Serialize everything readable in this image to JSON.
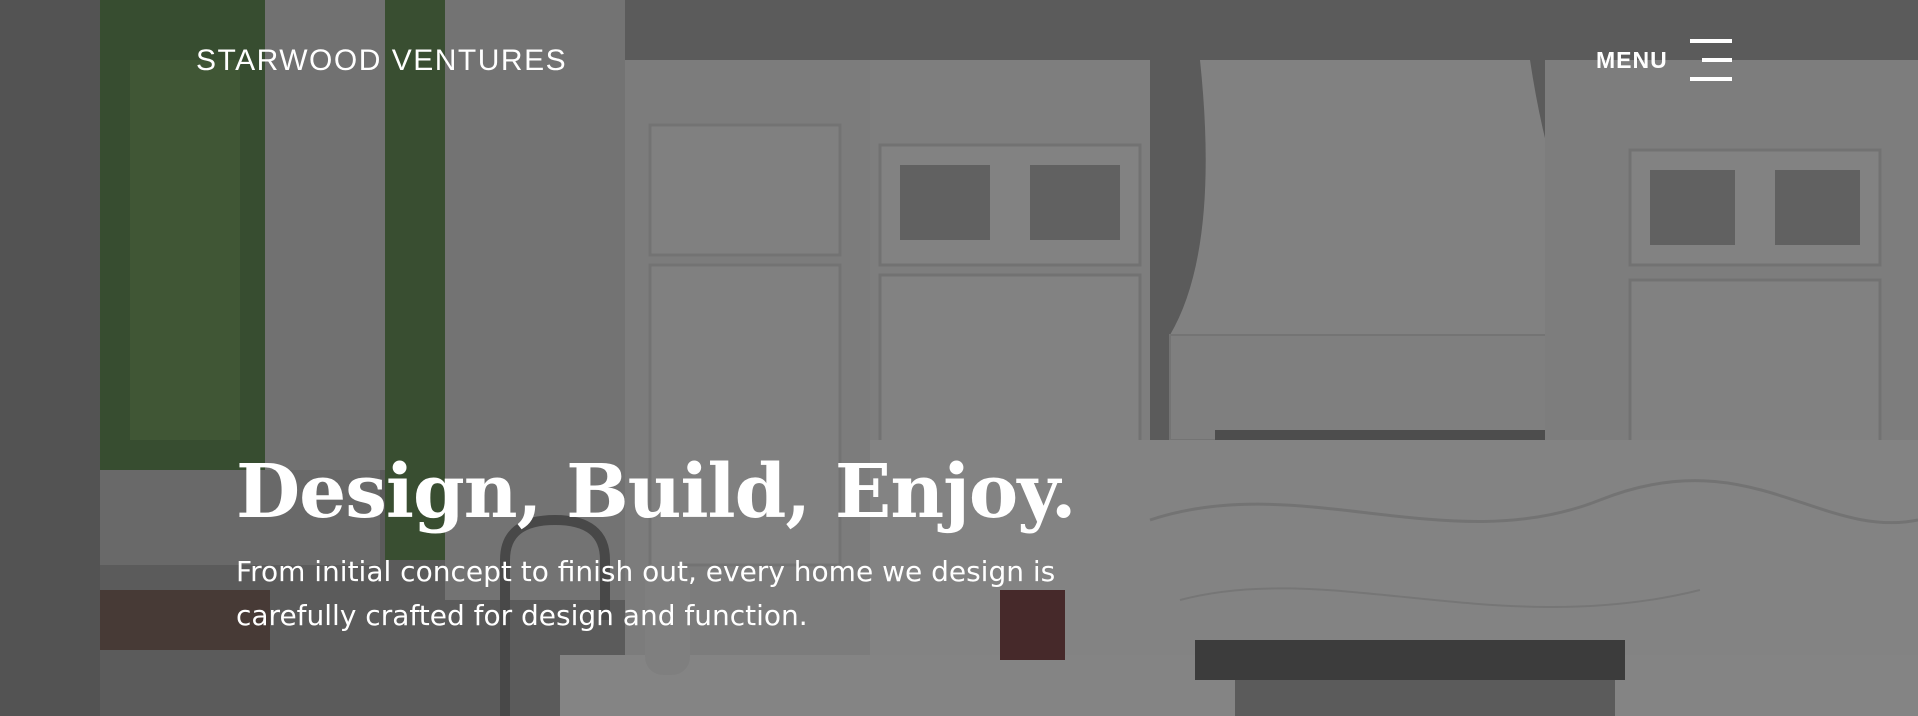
{
  "brand": {
    "name": "STARWOOD VENTURES"
  },
  "nav": {
    "menu_label": "MENU",
    "menu_icon": "hamburger-icon"
  },
  "hero": {
    "title": "Design, Build, Enjoy.",
    "text": "From initial concept to finish out, every home we design is carefully crafted for design and function.",
    "background_image": "kitchen-interior-photo"
  },
  "colors": {
    "overlay": "#282828",
    "text": "#ffffff"
  }
}
